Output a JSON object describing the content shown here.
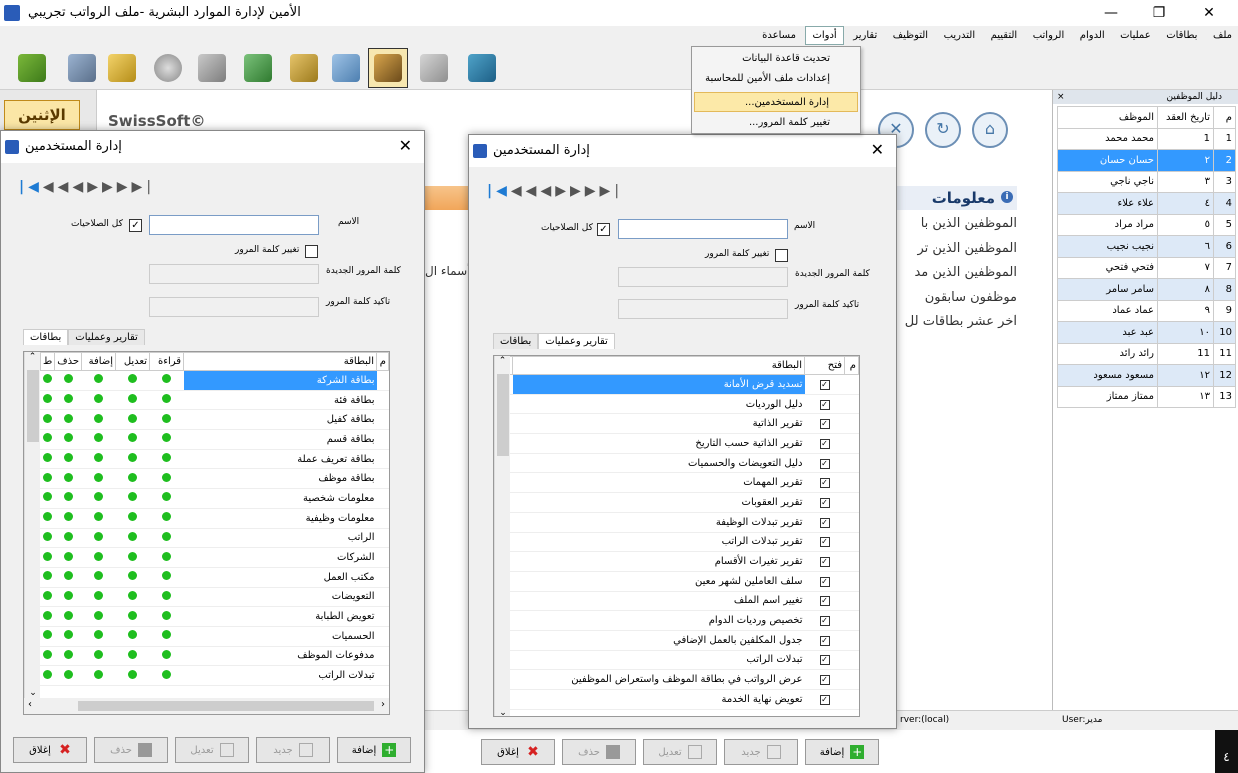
{
  "app": {
    "title": "الأمين لإدارة الموارد البشرية -ملف الرواتب تجريبي",
    "day": "الإثنين",
    "logo": "SwissSoft©"
  },
  "menu": [
    "ملف",
    "بطاقات",
    "عمليات",
    "الدوام",
    "الرواتب",
    "التقييم",
    "التدريب",
    "التوظيف",
    "تقارير",
    "أدوات",
    "مساعدة"
  ],
  "tools_menu": [
    "تحديث قاعدة البيانات",
    "إعدادات ملف الأمين للمحاسبة ...",
    "إدارة المستخدمين...",
    "تغيير كلمة المرور..."
  ],
  "info": {
    "header": "معلومات",
    "lines": [
      "الموظفين الذين با",
      "الموظفين الذين تر",
      "الموظفين الذين مد",
      "موظفون سابقون",
      "آخر عشر بطاقات لل"
    ],
    "fragment": "أسماء ال"
  },
  "employees": {
    "title": "دليل الموظفين",
    "headers": [
      "م",
      "تاريخ العقد",
      "الموظف"
    ],
    "rows": [
      [
        "1",
        "1",
        "محمد محمد"
      ],
      [
        "2",
        "٢",
        "حسان حسان"
      ],
      [
        "3",
        "٣",
        "ناجي ناجي"
      ],
      [
        "4",
        "٤",
        "علاء علاء"
      ],
      [
        "5",
        "٥",
        "مراد مراد"
      ],
      [
        "6",
        "٦",
        "نجيب نجيب"
      ],
      [
        "7",
        "٧",
        "فتحي فتحي"
      ],
      [
        "8",
        "٨",
        "سامر سامر"
      ],
      [
        "9",
        "٩",
        "عماد عماد"
      ],
      [
        "10",
        "١٠",
        "عبد عبد"
      ],
      [
        "11",
        "11",
        "رائد رائد"
      ],
      [
        "12",
        "١٢",
        "مسعود مسعود"
      ],
      [
        "13",
        "١٣",
        "ممتاز ممتاز"
      ]
    ]
  },
  "status": {
    "server": "rver:(local)",
    "user": "User:مدير",
    "corner": "٤"
  },
  "dialog": {
    "title": "إدارة المستخدمين",
    "name_label": "الاسم",
    "all_perms": "كل الصلاحيات",
    "change_pwd": "تغيير كلمة المرور",
    "new_pwd": "كلمة المرور الجديدة",
    "confirm_pwd": "تاكيد كلمة المرور",
    "tab_cards": "بطاقات",
    "tab_reports": "تقارير وعمليات",
    "buttons": {
      "add": "إضافة",
      "new": "جديد",
      "edit": "تعديل",
      "delete": "حذف",
      "close": "إغلاق"
    }
  },
  "cards_grid": {
    "headers": [
      "م",
      "البطاقة",
      "قراءة",
      "تعديل",
      "إضافة",
      "حذف",
      "ط"
    ],
    "rows": [
      "بطاقة الشركة",
      "بطاقة فئة",
      "بطاقة كفيل",
      "بطاقة قسم",
      "بطاقة تعريف عملة",
      "بطاقة موظف",
      "معلومات شخصية",
      "معلومات وظيفية",
      "الراتب",
      "الشركات",
      "مكتب العمل",
      "التعويضات",
      "تعويض الطبابة",
      "الحسميات",
      "مدفوعات الموظف",
      "تبدلات الراتب"
    ]
  },
  "reports_grid": {
    "headers": [
      "م",
      "البطاقة",
      "فتح"
    ],
    "rows": [
      "تسديد قرض الأمانة",
      "دليل الورديات",
      "تقرير الذاتية",
      "تقرير الذاتية حسب التاريخ",
      "دليل التعويضات والحسميات",
      "تقرير المهمات",
      "تقرير العقوبات",
      "تقرير تبدلات الوظيفة",
      "تقرير تبدلات الراتب",
      "تقرير تغيرات الأقسام",
      "سلف العاملين لشهر معين",
      "تغيير اسم الملف",
      "تخصيص ورديات الدوام",
      "جدول المكلفين بالعمل الإضافي",
      "تبدلات الراتب",
      "عرض الرواتب في بطاقة الموظف واستعراض الموظفين",
      "تعويض نهاية الخدمة"
    ]
  },
  "colors": {
    "selection": "#3399ff",
    "dot": "#1fbe1f",
    "highlight": "#fce9a8"
  }
}
